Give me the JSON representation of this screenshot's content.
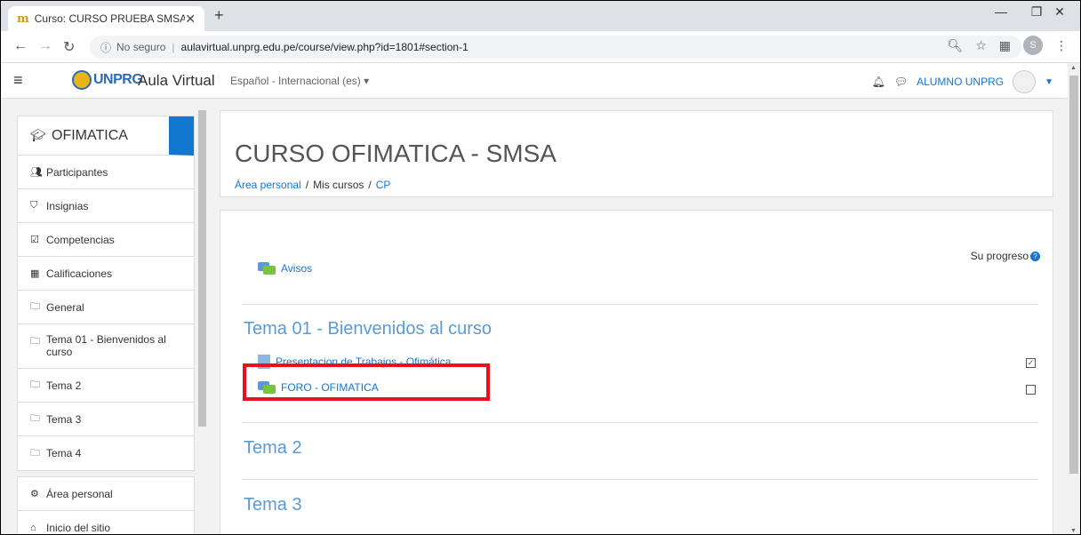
{
  "browser": {
    "tab_title": "Curso: CURSO PRUEBA SMSA",
    "new_tab": "+",
    "security_label": "No seguro",
    "url": "aulavirtual.unprg.edu.pe/course/view.php?id=1801#section-1",
    "profile_initial": "S"
  },
  "navbar": {
    "logo_text": "UNPRG",
    "brand": "Aula Virtual",
    "language": "Español - Internacional (es) ▾",
    "user": "ALUMNO UNPRG"
  },
  "drawer": {
    "course_label": "OFIMATICA",
    "items": [
      {
        "icon": "users-icon",
        "label": "Participantes"
      },
      {
        "icon": "shield-icon",
        "label": "Insignias"
      },
      {
        "icon": "checkbox-icon",
        "label": "Competencias"
      },
      {
        "icon": "table-icon",
        "label": "Calificaciones"
      },
      {
        "icon": "folder-icon",
        "label": "General"
      },
      {
        "icon": "folder-icon",
        "label": "Tema 01 - Bienvenidos al curso"
      },
      {
        "icon": "folder-icon",
        "label": "Tema 2"
      },
      {
        "icon": "folder-icon",
        "label": "Tema 3"
      },
      {
        "icon": "folder-icon",
        "label": "Tema 4"
      }
    ],
    "items2": [
      {
        "icon": "dashboard-icon",
        "label": "Área personal"
      },
      {
        "icon": "home-icon",
        "label": "Inicio del sitio"
      }
    ]
  },
  "page": {
    "title": "CURSO OFIMATICA - SMSA",
    "breadcrumb": [
      "Área personal",
      "Mis cursos",
      "CP"
    ]
  },
  "course": {
    "progress_label": "Su progreso",
    "avisos": "Avisos",
    "section1_title": "Tema 01 - Bienvenidos al curso",
    "activity1": "Presentacion de Trabajos - Ofimática",
    "activity2": "FORO - OFIMATICA",
    "section2_title": "Tema 2",
    "section3_title": "Tema 3"
  }
}
